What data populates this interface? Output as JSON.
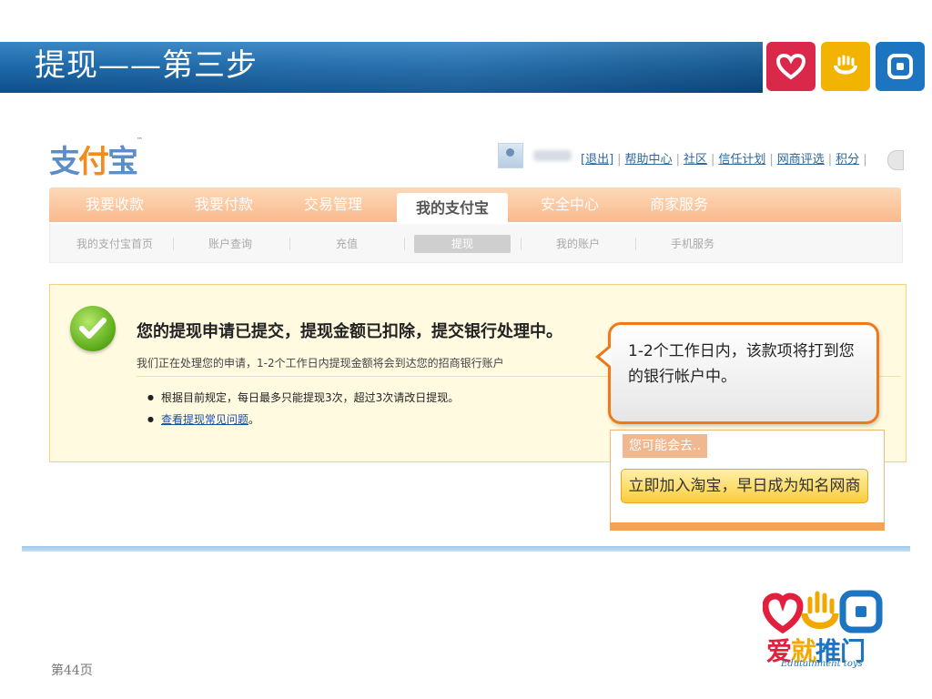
{
  "slide": {
    "title": "提现——第三步",
    "page_number": "第44页"
  },
  "brand": {
    "colors": {
      "heart": "#d9284a",
      "hand": "#f2b400",
      "square": "#1d74c0"
    },
    "logo_chars": [
      "爱",
      "就",
      "推",
      "门"
    ],
    "logo_subtitle": "Edutainment toys"
  },
  "alipay": {
    "logo_main": "支",
    "logo_fu": "付",
    "logo_bao": "宝",
    "logo_tm": "™",
    "top_links": {
      "logout": "[退出]",
      "help": "帮助中心",
      "community": "社区",
      "trust": "信任计划",
      "rating": "网商评选",
      "points": "积分"
    },
    "nav_tabs": [
      "我要收款",
      "我要付款",
      "交易管理",
      "我的支付宝",
      "安全中心",
      "商家服务"
    ],
    "active_tab": "我的支付宝",
    "sub_nav": [
      "我的支付宝首页",
      "账户查询",
      "充值",
      "提现",
      "我的账户",
      "手机服务"
    ],
    "active_sub": "提现",
    "message": {
      "title": "您的提现申请已提交，提现金额已扣除，提交银行处理中。",
      "subtitle": "我们正在处理您的申请，1-2个工作日内提现金额将会到达您的招商银行账户",
      "bullet_rule": "根据目前规定，每日最多只能提现3次，超过3次请改日提现。",
      "bullet_faq": "查看提现常见问题",
      "bullet_faq_suffix": "。"
    },
    "suggestion": {
      "label": "您可能会去..",
      "button": "立即加入淘宝，早日成为知名网商"
    }
  },
  "callout": {
    "text": "1-2个工作日内，该款项将打到您的银行帐户中。"
  }
}
